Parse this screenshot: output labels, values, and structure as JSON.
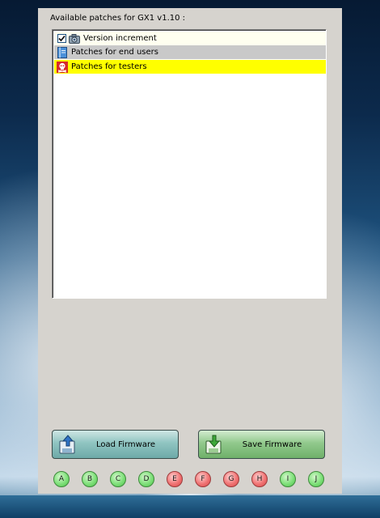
{
  "panel": {
    "caption": "Available patches for GX1 v1.10 :"
  },
  "patches": [
    {
      "label": "Version increment",
      "checked": true,
      "icon": "camera-icon",
      "highlight": "#fffff0"
    },
    {
      "label": "Patches for end users",
      "icon": "book-icon",
      "highlight": "#c9c9c9"
    },
    {
      "label": "Patches for testers",
      "icon": "skull-icon",
      "highlight": "#ffff00"
    }
  ],
  "buttons": {
    "load_label": "Load Firmware",
    "save_label": "Save Firmware"
  },
  "indicators": [
    {
      "label": "A",
      "color": "green"
    },
    {
      "label": "B",
      "color": "green"
    },
    {
      "label": "C",
      "color": "green"
    },
    {
      "label": "D",
      "color": "green"
    },
    {
      "label": "E",
      "color": "red"
    },
    {
      "label": "F",
      "color": "red"
    },
    {
      "label": "G",
      "color": "red"
    },
    {
      "label": "H",
      "color": "red"
    },
    {
      "label": "I",
      "color": "green"
    },
    {
      "label": "J",
      "color": "green"
    }
  ]
}
